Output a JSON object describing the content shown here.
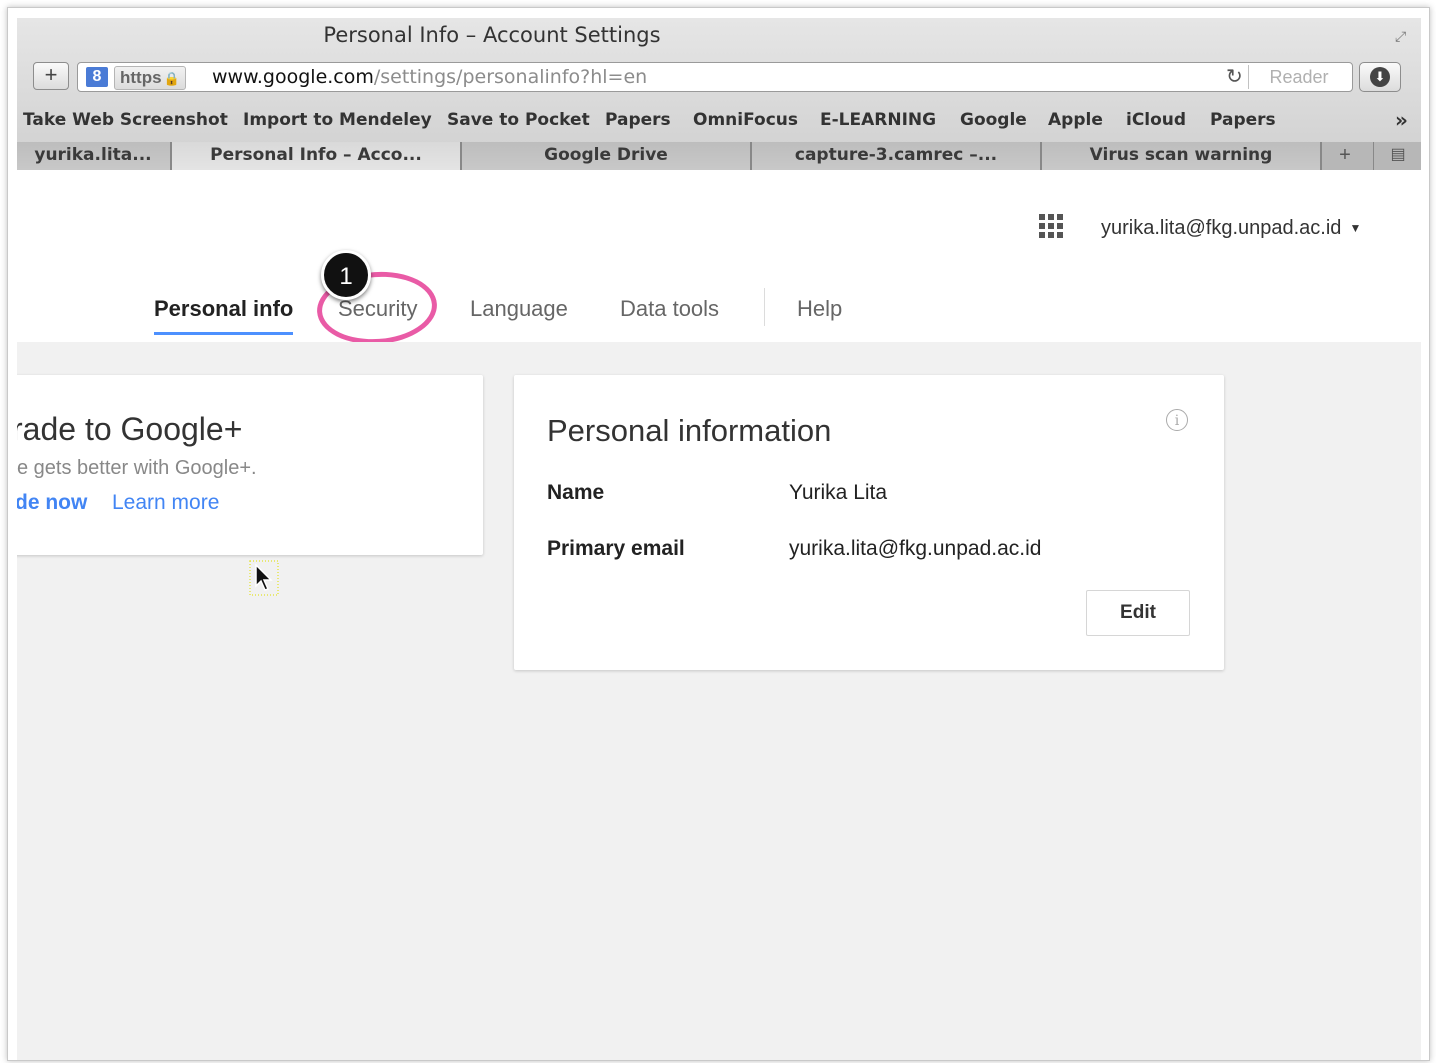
{
  "window": {
    "title": "Personal Info – Account Settings"
  },
  "toolbar": {
    "new_tab_symbol": "+",
    "site_badge": "8",
    "https_label": "https",
    "url_domain": "www.google.com",
    "url_path": "/settings/personalinfo?hl=en",
    "reader_label": "Reader"
  },
  "bookmarks": [
    {
      "label": "Take Web Screenshot"
    },
    {
      "label": "Import to Mendeley"
    },
    {
      "label": "Save to Pocket"
    },
    {
      "label": "Papers"
    },
    {
      "label": "OmniFocus"
    },
    {
      "label": "E-LEARNING"
    },
    {
      "label": "Google"
    },
    {
      "label": "Apple"
    },
    {
      "label": "iCloud"
    },
    {
      "label": "Papers"
    }
  ],
  "browser_tabs": [
    {
      "label": "yurika.lita...",
      "active": false
    },
    {
      "label": "Personal Info – Acco...",
      "active": true
    },
    {
      "label": "Google Drive",
      "active": false
    },
    {
      "label": "capture-3.camrec –...",
      "active": false
    },
    {
      "label": "Virus scan warning",
      "active": false
    }
  ],
  "header": {
    "account_email": "yurika.lita@fkg.unpad.ac.id"
  },
  "nav": {
    "tabs": [
      {
        "label": "Personal info",
        "active": true
      },
      {
        "label": "Security",
        "active": false
      },
      {
        "label": "Language",
        "active": false
      },
      {
        "label": "Data tools",
        "active": false
      },
      {
        "label": "Help",
        "active": false
      }
    ]
  },
  "annotation": {
    "step_number": "1",
    "highlight_color": "#e95ba6"
  },
  "upgrade_card": {
    "title": "rade to Google+",
    "subtitle": "e gets better with Google+.",
    "primary_link": "de now",
    "secondary_link": "Learn more"
  },
  "personal_info": {
    "title": "Personal information",
    "fields": [
      {
        "label": "Name",
        "value": "Yurika Lita"
      },
      {
        "label": "Primary email",
        "value": "yurika.lita@fkg.unpad.ac.id"
      }
    ],
    "edit_label": "Edit"
  },
  "colors": {
    "accent_blue": "#4285f4",
    "tab_underline": "#4d90fe",
    "content_bg": "#f1f1f1"
  }
}
